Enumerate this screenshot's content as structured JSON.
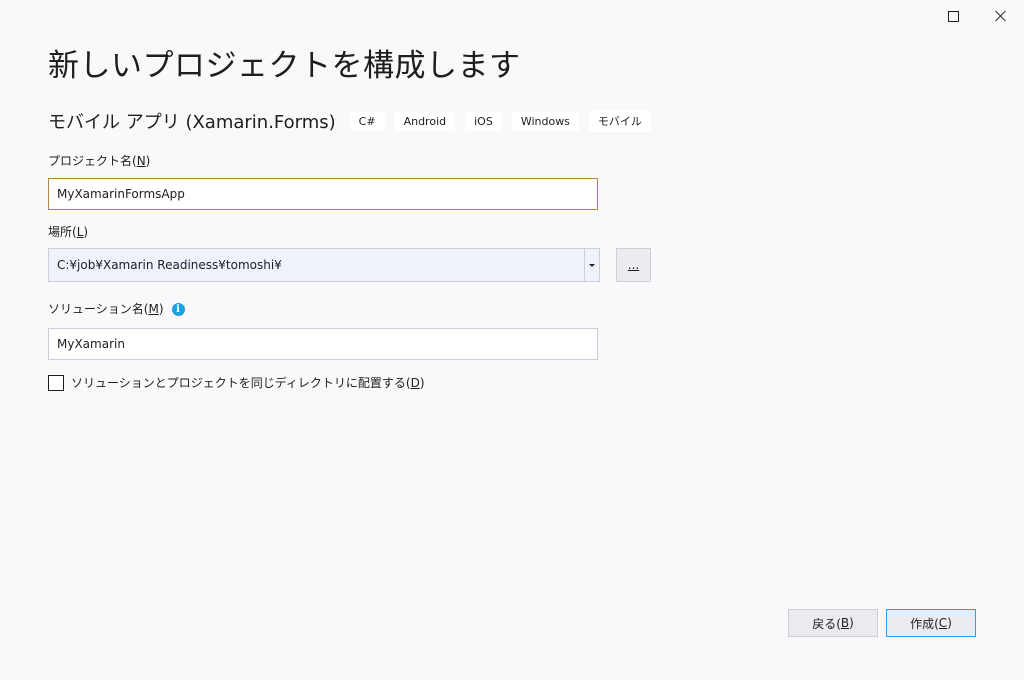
{
  "window": {
    "maximize_icon": "maximize-icon",
    "close_icon": "close-icon"
  },
  "page_title": "新しいプロジェクトを構成します",
  "template": {
    "name": "モバイル アプリ (Xamarin.Forms)",
    "tags": [
      "C#",
      "Android",
      "iOS",
      "Windows",
      "モバイル"
    ]
  },
  "project_name": {
    "label": "プロジェクト名(",
    "mnemonic": "N",
    "label_end": ")",
    "value": "MyXamarinFormsApp"
  },
  "location": {
    "label": "場所(",
    "mnemonic": "L",
    "label_end": ")",
    "value": "C:¥job¥Xamarin Readiness¥tomoshi¥",
    "browse_label": "..."
  },
  "solution_name": {
    "label": "ソリューション名(",
    "mnemonic": "M",
    "label_end": ")",
    "info_icon": "i",
    "value": "MyXamarin"
  },
  "same_directory": {
    "label": "ソリューションとプロジェクトを同じディレクトリに配置する(",
    "mnemonic": "D",
    "label_end": ")",
    "checked": false
  },
  "footer": {
    "back_label": "戻る(",
    "back_mnemonic": "B",
    "back_end": ")",
    "create_label": "作成(",
    "create_mnemonic": "C",
    "create_end": ")"
  },
  "colors": {
    "background": "#f9f9fb",
    "focus_border": "#b38a3b",
    "info_blue": "#1ba1e2",
    "default_button_border": "#3399ff"
  }
}
